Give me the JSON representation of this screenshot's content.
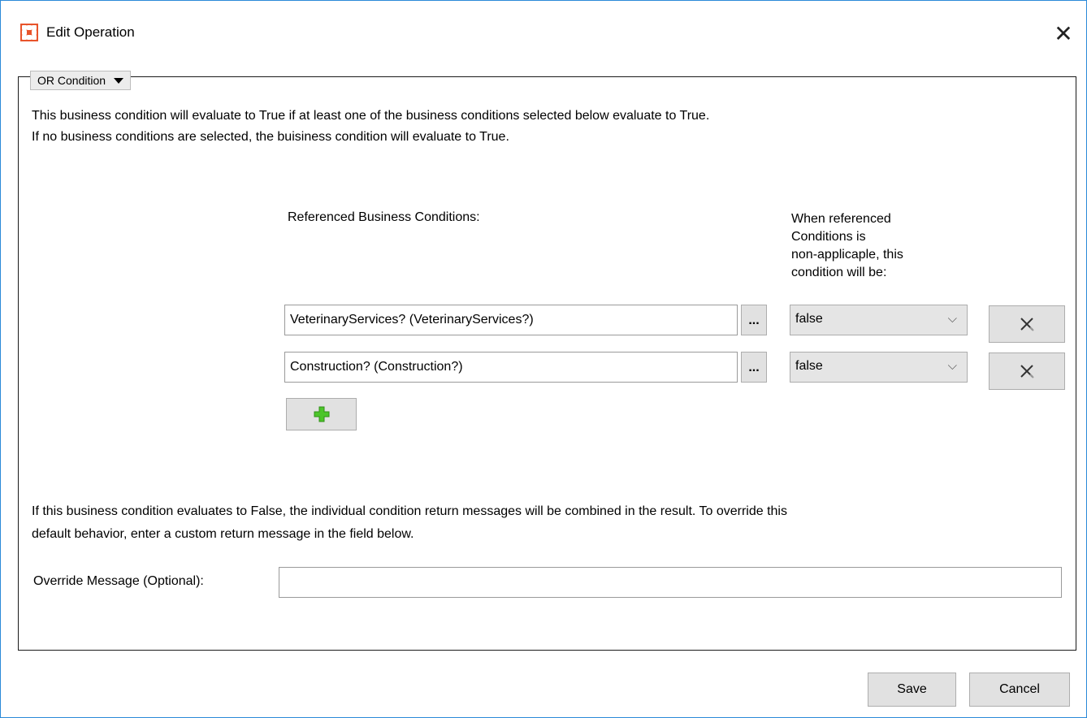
{
  "window": {
    "title": "Edit Operation",
    "close_glyph": "✕",
    "icon": "app-logo-icon"
  },
  "group": {
    "dropdown_label": "OR Condition"
  },
  "description": {
    "line1": "This business condition will evaluate to True if at least one of the business conditions selected below evaluate to True.",
    "line2": "If no business conditions are selected, the buisiness condition will evaluate to True."
  },
  "columns": {
    "referenced_label": "Referenced Business Conditions:",
    "nonapplicable_lines": [
      "When referenced",
      "Conditions is",
      "non-applicaple, this",
      "condition will be:"
    ]
  },
  "conditions": [
    {
      "reference": "VeterinaryServices? (VeterinaryServices?)",
      "browse_label": "...",
      "when_nonapplicable": "false"
    },
    {
      "reference": "Construction? (Construction?)",
      "browse_label": "...",
      "when_nonapplicable": "false"
    }
  ],
  "note": {
    "line1": "If this business condition evaluates to False, the individual condition return messages will be combined in the result. To override this",
    "line2": "default behavior, enter a custom return message in the field below."
  },
  "override": {
    "label": "Override Message (Optional):",
    "value": "",
    "placeholder": ""
  },
  "footer": {
    "save_label": "Save",
    "cancel_label": "Cancel"
  },
  "colors": {
    "accent_border": "#2b8ad8",
    "logo": "#e8542b",
    "add_icon": "#4cc52a"
  }
}
